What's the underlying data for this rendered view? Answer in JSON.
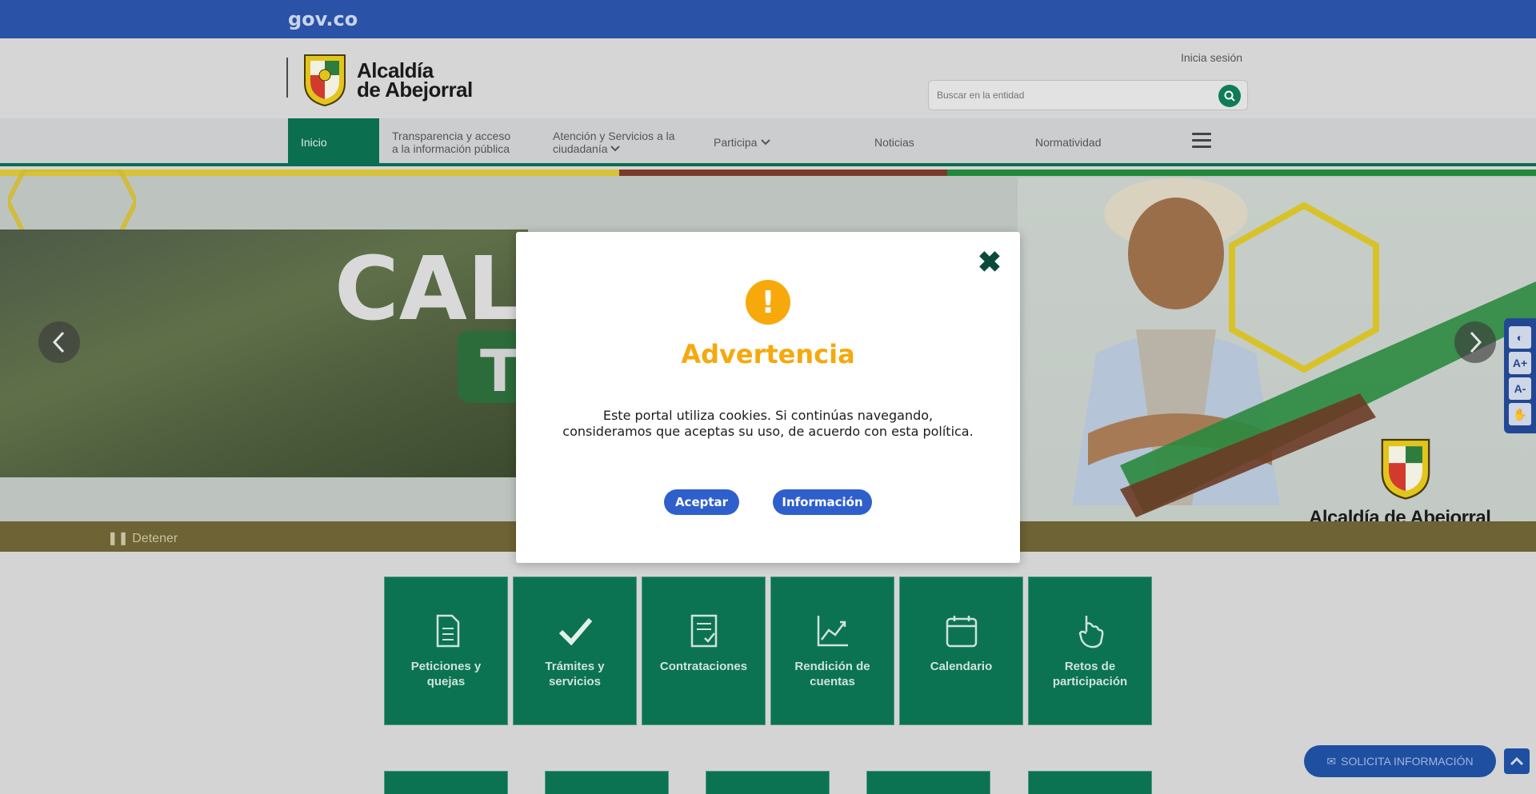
{
  "gov_bar": {
    "logo": "gov.co"
  },
  "header": {
    "entity_name_line1": "Alcaldía",
    "entity_name_line2": "de Abejorral",
    "login": "Inicia sesión",
    "search_placeholder": "Buscar en la entidad"
  },
  "nav": {
    "items": [
      {
        "label": "Inicio"
      },
      {
        "label_line1": "Transparencia y acceso",
        "label_line2": "a la información pública"
      },
      {
        "label_line1": "Atención y Servicios a la",
        "label_line2": "ciudadanía"
      },
      {
        "label": "Participa"
      },
      {
        "label": "Noticias"
      },
      {
        "label": "Normatividad"
      }
    ]
  },
  "slider": {
    "text_large": "CAL",
    "text_green": "T",
    "stop_label": "Detener",
    "brand_bottom": "Alcaldía de Abejorral"
  },
  "tiles": [
    {
      "line1": "Peticiones y",
      "line2": "quejas",
      "icon": "document-icon"
    },
    {
      "line1": "Trámites y",
      "line2": "servicios",
      "icon": "check-icon"
    },
    {
      "line1": "Contrataciones",
      "line2": "",
      "icon": "contract-icon"
    },
    {
      "line1": "Rendición de",
      "line2": "cuentas",
      "icon": "chart-icon"
    },
    {
      "line1": "Calendario",
      "line2": "",
      "icon": "calendar-icon"
    },
    {
      "line1": "Retos de",
      "line2": "participación",
      "icon": "hand-icon"
    }
  ],
  "widgets": {
    "solicita": "SOLICITA INFORMACIÓN"
  },
  "modal": {
    "title": "Advertencia",
    "icon_glyph": "!",
    "body_line1": "Este portal utiliza cookies. Si continúas navegando,",
    "body_line2": "consideramos que aceptas su uso, de acuerdo con esta política.",
    "accept": "Aceptar",
    "info": "Información",
    "close_glyph": "✖"
  },
  "colors": {
    "gov_blue": "#2a52a6",
    "brand_green": "#0b7352",
    "warning_orange": "#f7a90c",
    "button_blue": "#2f5fcc"
  }
}
